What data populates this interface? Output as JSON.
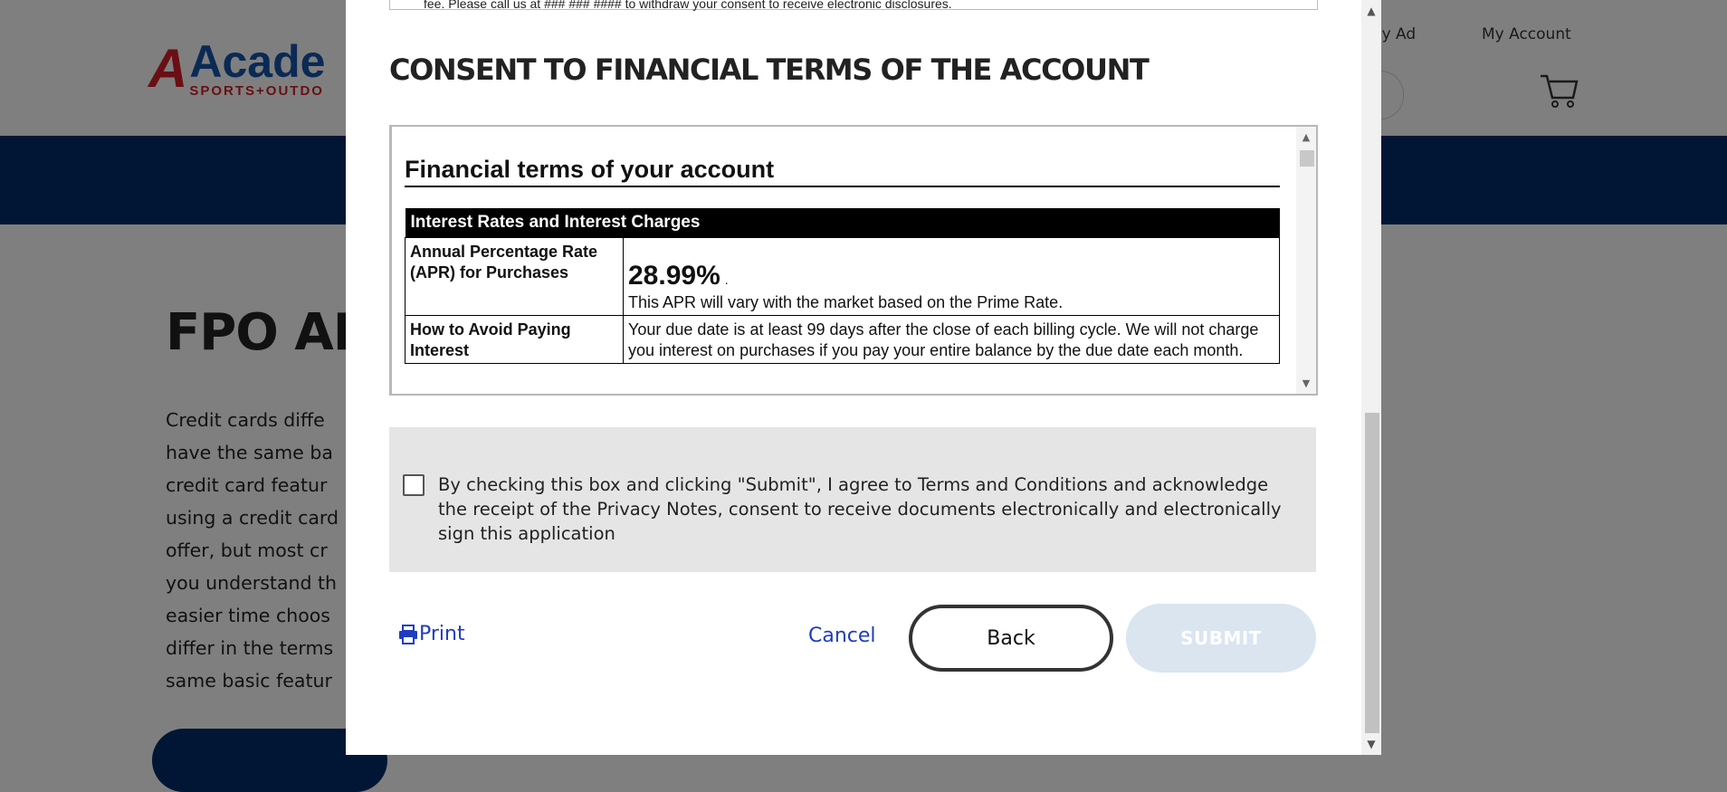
{
  "background_page": {
    "logo": {
      "mark": "A",
      "word": "Acade",
      "sub": "SPORTS+OUTDO"
    },
    "nav_links": [
      {
        "label": "kly Ad"
      },
      {
        "label": "My Account"
      }
    ],
    "heading": "FPO APR",
    "body_lines": [
      "Credit cards diffe",
      "have the same ba",
      "credit card featur",
      "using a credit card",
      "offer, but most cr",
      "you understand th",
      "easier time choos",
      "differ in the terms",
      "same basic featur"
    ],
    "colors": {
      "nav_band": "#001634",
      "overlay": "#7f7f7f"
    }
  },
  "modal": {
    "prev_section_text": "fee. Please call us at ### ### #### to withdraw your consent to receive electronic disclosures.",
    "title": "CONSENT TO FINANCIAL TERMS OF THE ACCOUNT",
    "terms": {
      "title": "Financial terms of your account",
      "table_header": "Interest Rates and Interest Charges",
      "rows": [
        {
          "label": "Annual Percentage Rate (APR) for Purchases",
          "apr_value": "28.99%",
          "apr_suffix": ".",
          "description": "This APR will vary with the market based on the Prime Rate."
        },
        {
          "label": "How to Avoid Paying Interest",
          "description": "Your due date is at least 99 days after the close of each billing cycle. We will not charge you interest on purchases if you pay your entire balance by the due date each month."
        }
      ]
    },
    "consent": {
      "checked": false,
      "text": "By checking this box and clicking \"Submit\", I agree to Terms and Conditions and acknowledge the receipt of the Privacy Notes, consent to receive documents electronically and electronically sign this application"
    },
    "actions": {
      "print_label": "Print",
      "cancel_label": "Cancel",
      "back_label": "Back",
      "submit_label": "SUBMIT",
      "submit_enabled": false
    },
    "colors": {
      "link": "#1f3dbf",
      "submit_disabled_bg": "#dae5f0",
      "consent_panel_bg": "#e5e5e5"
    }
  }
}
